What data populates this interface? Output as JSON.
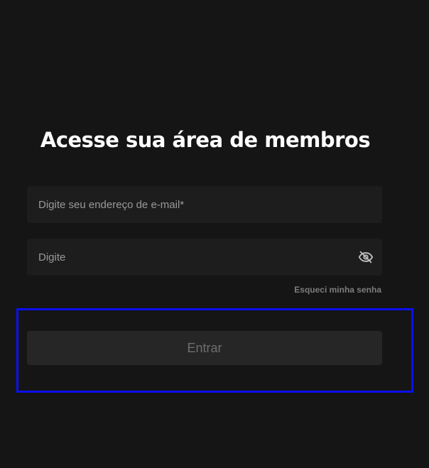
{
  "login": {
    "title": "Acesse sua área de membros",
    "email": {
      "placeholder": "Digite seu endereço de e-mail*",
      "value": ""
    },
    "password": {
      "placeholder": "Digite",
      "value": "",
      "toggle_icon": "eye-off-icon"
    },
    "forgot_link": "Esqueci minha senha",
    "submit_label": "Entrar"
  },
  "colors": {
    "background": "#151515",
    "input_background": "#1d1d1d",
    "button_background": "#262626",
    "highlight_border": "#0a10f0",
    "title_text": "#ffffff"
  }
}
